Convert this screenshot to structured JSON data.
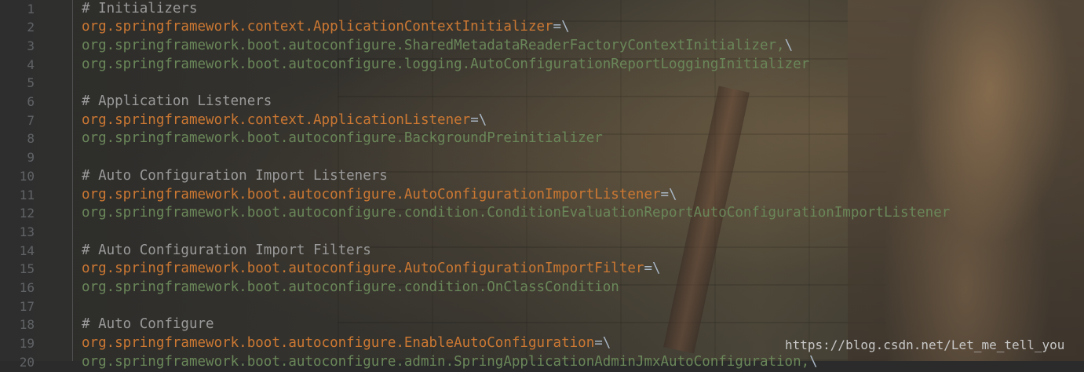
{
  "editor": {
    "lines": [
      {
        "number": "1",
        "parts": [
          {
            "text": "# Initializers",
            "kind": "comment"
          }
        ]
      },
      {
        "number": "2",
        "parts": [
          {
            "text": "org.springframework.context.ApplicationContextInitializer",
            "kind": "key"
          },
          {
            "text": "=\\",
            "kind": "sep"
          }
        ]
      },
      {
        "number": "3",
        "parts": [
          {
            "text": "org.springframework.boot.autoconfigure.SharedMetadataReaderFactoryContextInitializer,",
            "kind": "value"
          },
          {
            "text": "\\",
            "kind": "sep"
          }
        ]
      },
      {
        "number": "4",
        "parts": [
          {
            "text": "org.springframework.boot.autoconfigure.logging.AutoConfigurationReportLoggingInitializer",
            "kind": "value"
          }
        ]
      },
      {
        "number": "5",
        "parts": []
      },
      {
        "number": "6",
        "parts": [
          {
            "text": "# Application Listeners",
            "kind": "comment"
          }
        ]
      },
      {
        "number": "7",
        "parts": [
          {
            "text": "org.springframework.context.ApplicationListener",
            "kind": "key"
          },
          {
            "text": "=\\",
            "kind": "sep"
          }
        ]
      },
      {
        "number": "8",
        "parts": [
          {
            "text": "org.springframework.boot.autoconfigure.BackgroundPreinitializer",
            "kind": "value"
          }
        ]
      },
      {
        "number": "9",
        "parts": []
      },
      {
        "number": "10",
        "parts": [
          {
            "text": "# Auto Configuration Import Listeners",
            "kind": "comment"
          }
        ]
      },
      {
        "number": "11",
        "parts": [
          {
            "text": "org.springframework.boot.autoconfigure.AutoConfigurationImportListener",
            "kind": "key"
          },
          {
            "text": "=\\",
            "kind": "sep"
          }
        ]
      },
      {
        "number": "12",
        "parts": [
          {
            "text": "org.springframework.boot.autoconfigure.condition.ConditionEvaluationReportAutoConfigurationImportListener",
            "kind": "value"
          }
        ]
      },
      {
        "number": "13",
        "parts": []
      },
      {
        "number": "14",
        "parts": [
          {
            "text": "# Auto Configuration Import Filters",
            "kind": "comment"
          }
        ]
      },
      {
        "number": "15",
        "parts": [
          {
            "text": "org.springframework.boot.autoconfigure.AutoConfigurationImportFilter",
            "kind": "key"
          },
          {
            "text": "=\\",
            "kind": "sep"
          }
        ]
      },
      {
        "number": "16",
        "parts": [
          {
            "text": "org.springframework.boot.autoconfigure.condition.OnClassCondition",
            "kind": "value"
          }
        ]
      },
      {
        "number": "17",
        "parts": []
      },
      {
        "number": "18",
        "parts": [
          {
            "text": "# Auto Configure",
            "kind": "comment"
          }
        ]
      },
      {
        "number": "19",
        "parts": [
          {
            "text": "org.springframework.boot.autoconfigure.EnableAutoConfiguration",
            "kind": "key"
          },
          {
            "text": "=\\",
            "kind": "sep"
          }
        ]
      },
      {
        "number": "20",
        "parts": [
          {
            "text": "org.springframework.boot.autoconfigure.admin.SpringApplicationAdminJmxAutoConfiguration,",
            "kind": "value"
          },
          {
            "text": "\\",
            "kind": "sep"
          }
        ]
      }
    ]
  },
  "watermark": "https://blog.csdn.net/Let_me_tell_you",
  "colors": {
    "background": "#2b2b2b",
    "comment": "#9a9a9a",
    "key": "#cc7832",
    "value": "#6a8759",
    "line_number": "#606366"
  }
}
